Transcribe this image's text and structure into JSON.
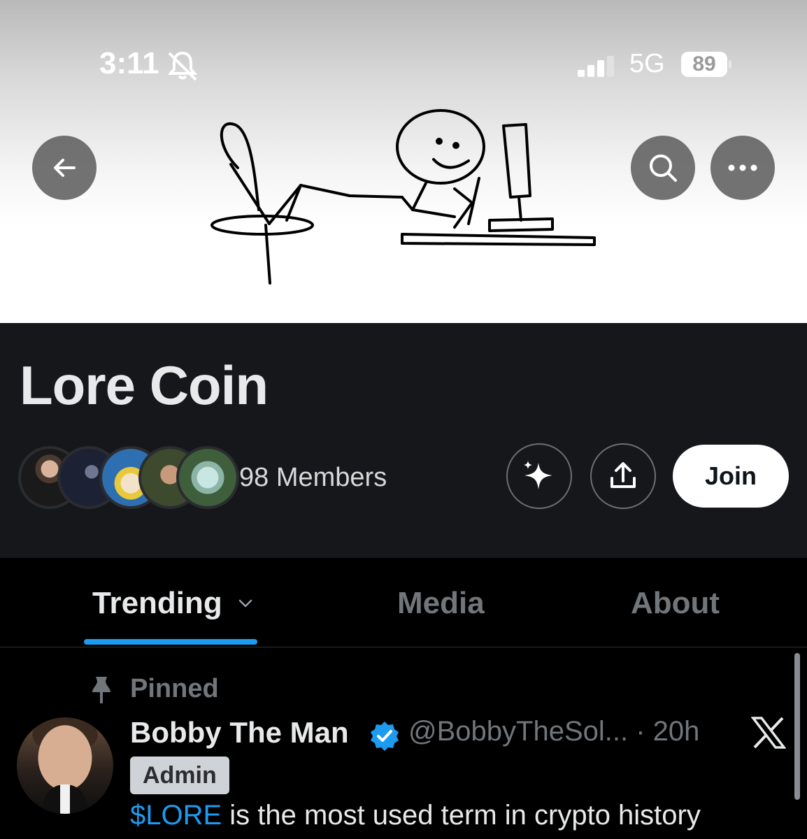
{
  "status_bar": {
    "time": "3:11",
    "network": "5G",
    "battery": "89",
    "icons": [
      "bell-slash-icon",
      "signal-bars-icon"
    ]
  },
  "banner": {
    "back_icon": "arrow-left-icon",
    "search_icon": "search-icon",
    "more_icon": "more-horizontal-icon",
    "image": "stick-figure-computer-doodle"
  },
  "community": {
    "title": "Lore Coin",
    "members_label": "98 Members",
    "grok_icon": "sparkle-icon",
    "share_icon": "share-icon",
    "join_label": "Join"
  },
  "tabs": {
    "items": [
      {
        "label": "Trending",
        "active": true
      },
      {
        "label": "Media",
        "active": false
      },
      {
        "label": "About",
        "active": false
      }
    ]
  },
  "post": {
    "pinned_label": "Pinned",
    "author_name": "Bobby The Man",
    "handle_time": "@BobbyTheSol... · 20h",
    "badge": "Admin",
    "cashtag": "$LORE",
    "text_rest": " is the most used term in crypto history"
  },
  "colors": {
    "accent": "#1d9bf0",
    "header_bg": "#16171b",
    "page_bg": "#000000",
    "muted_text": "#71767b"
  }
}
